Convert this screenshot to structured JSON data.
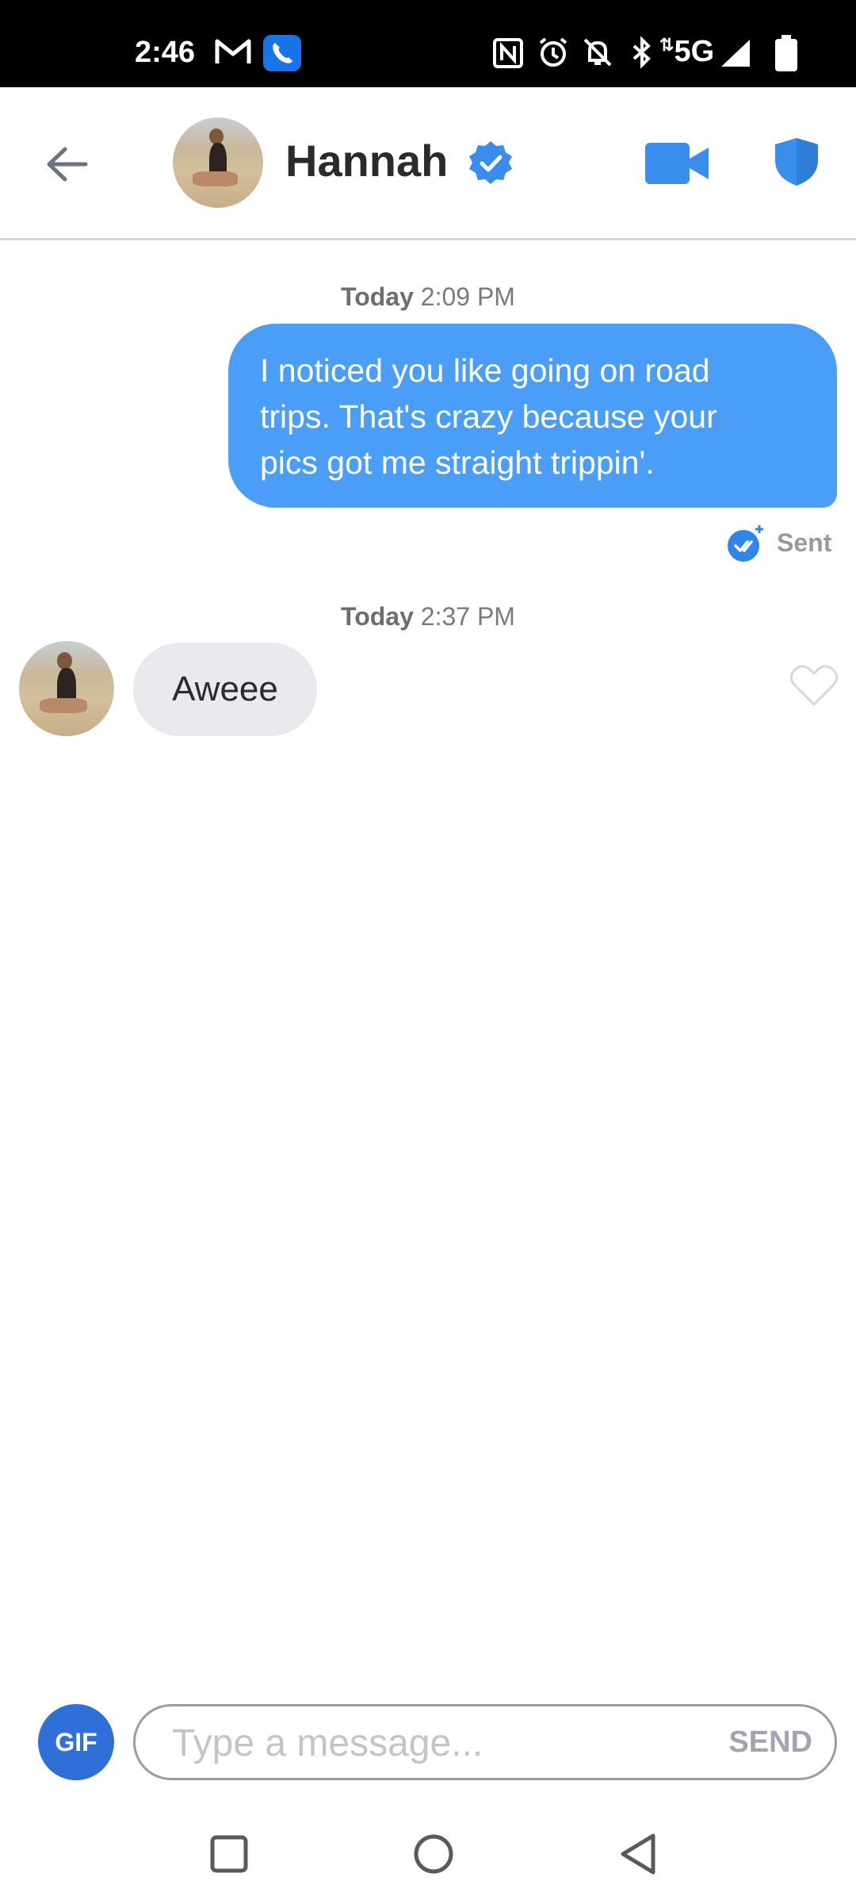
{
  "status_bar": {
    "time": "2:46",
    "icons": [
      "gmail-icon",
      "phone-call-icon",
      "nfc-icon",
      "alarm-icon",
      "mute-icon",
      "bluetooth-icon",
      "5g-icon",
      "signal-icon",
      "battery-icon"
    ],
    "network": "5G"
  },
  "header": {
    "contact_name": "Hannah",
    "verified": true,
    "accent_color": "#3b8ded"
  },
  "messages": [
    {
      "timestamp_day": "Today",
      "timestamp_time": "2:09 PM",
      "direction": "sent",
      "lines": [
        "I noticed you like going on road",
        "trips. That's crazy because your",
        "pics got me straight trippin'."
      ],
      "status": "Sent"
    },
    {
      "timestamp_day": "Today",
      "timestamp_time": "2:37 PM",
      "direction": "received",
      "text": "Aweee"
    }
  ],
  "composer": {
    "gif_label": "GIF",
    "placeholder": "Type a message...",
    "send_label": "SEND"
  },
  "colors": {
    "sent_bubble": "#4b9ef7",
    "received_bubble": "#e9eaed",
    "gif_button": "#2f6fd8"
  }
}
